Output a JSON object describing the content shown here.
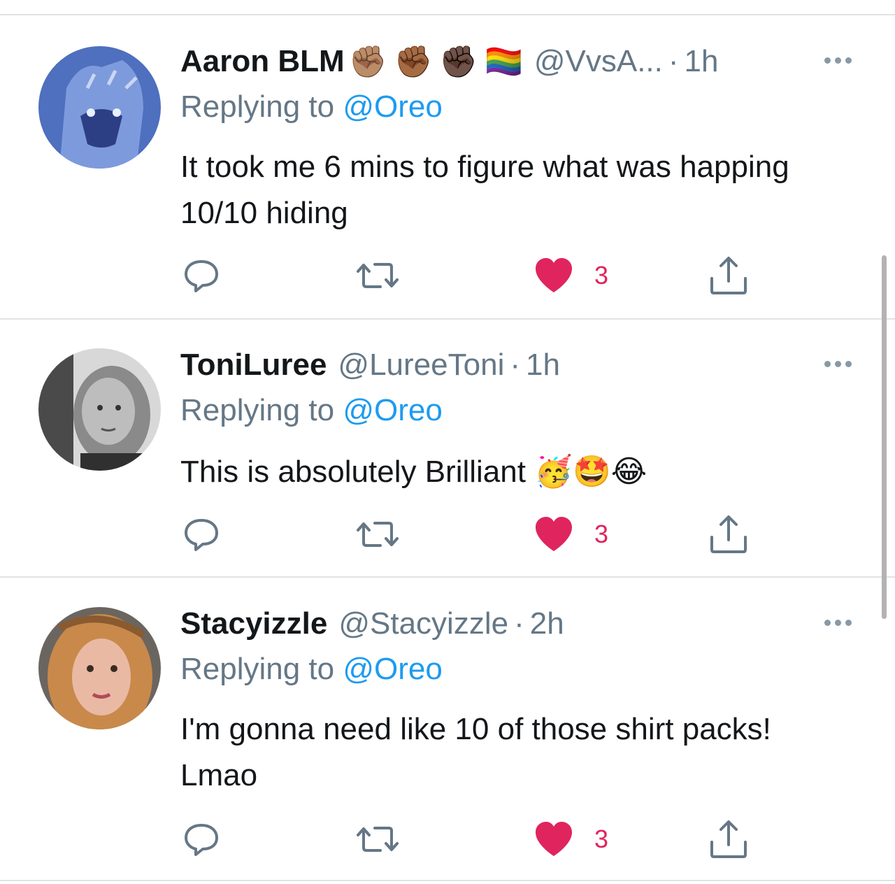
{
  "tweets": [
    {
      "name": "Aaron BLM",
      "badges": [
        "✊🏽",
        "✊🏾",
        "✊🏿",
        "🏳️‍🌈"
      ],
      "handle": "@VvsA...",
      "time": "1h",
      "replying_prefix": "Replying to ",
      "replying_to": "@Oreo",
      "text": "It took me 6 mins to figure what was happing 10/10 hiding",
      "likes": "3",
      "avatar": "blue-animal-avatar"
    },
    {
      "name": "ToniLuree",
      "badges": [],
      "handle": "@LureeToni",
      "time": "1h",
      "replying_prefix": "Replying to ",
      "replying_to": "@Oreo",
      "text": "This is absolutely Brilliant 🥳🤩😂",
      "likes": "3",
      "avatar": "grayscale-woman-avatar"
    },
    {
      "name": "Stacyizzle",
      "badges": [],
      "handle": "@Stacyizzle",
      "time": "2h",
      "replying_prefix": "Replying to ",
      "replying_to": "@Oreo",
      "text": "I'm gonna need like 10 of those shirt packs! Lmao",
      "likes": "3",
      "avatar": "curly-hair-woman-avatar"
    }
  ],
  "icons": {
    "reply": "reply-icon",
    "retweet": "retweet-icon",
    "like": "heart-icon",
    "share": "share-icon",
    "more": "more-options-icon"
  },
  "colors": {
    "accent": "#1d9bf0",
    "like": "#e0245e",
    "secondary_text": "#657786",
    "icon_gray": "#657786"
  }
}
